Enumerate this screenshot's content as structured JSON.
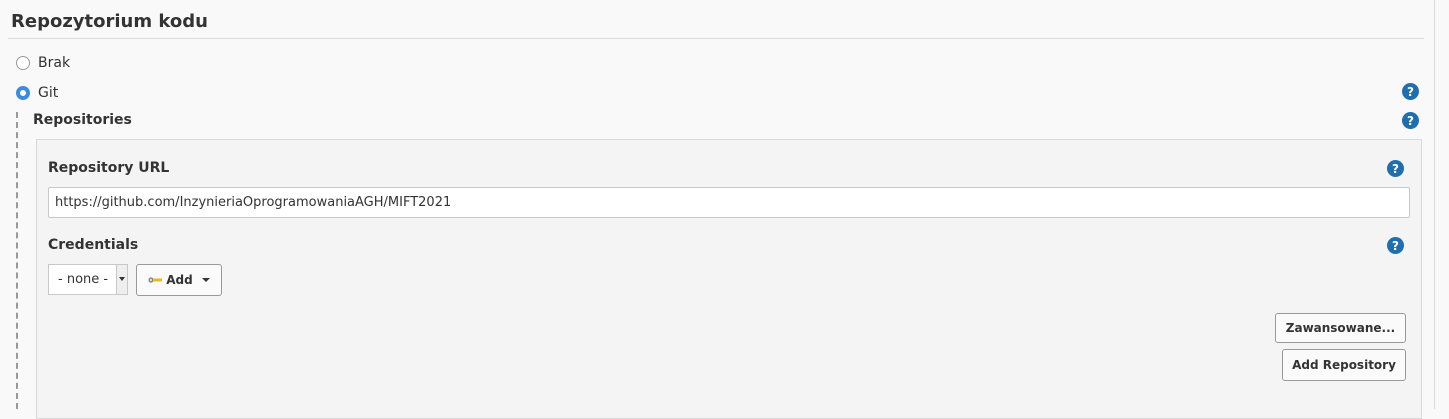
{
  "section": {
    "title": "Repozytorium kodu"
  },
  "scm_options": [
    {
      "label": "Brak",
      "selected": false
    },
    {
      "label": "Git",
      "selected": true
    }
  ],
  "help_icon_glyph": "?",
  "git": {
    "repositories_label": "Repositories",
    "repository_url_label": "Repository URL",
    "repository_url_value": "https://github.com/InzynieriaOprogramowaniaAGH/MIFT2021",
    "credentials_label": "Credentials",
    "credentials_selected": "- none -",
    "add_label": "Add",
    "advanced_label": "Zawansowane...",
    "add_repository_label": "Add Repository"
  },
  "colors": {
    "help_icon": "#1f6fb0",
    "radio_selected": "#3d8be0",
    "key_icon": "#e8b923"
  },
  "icons": [
    "help-icon",
    "key-icon",
    "caret-down-icon",
    "radio-button"
  ]
}
